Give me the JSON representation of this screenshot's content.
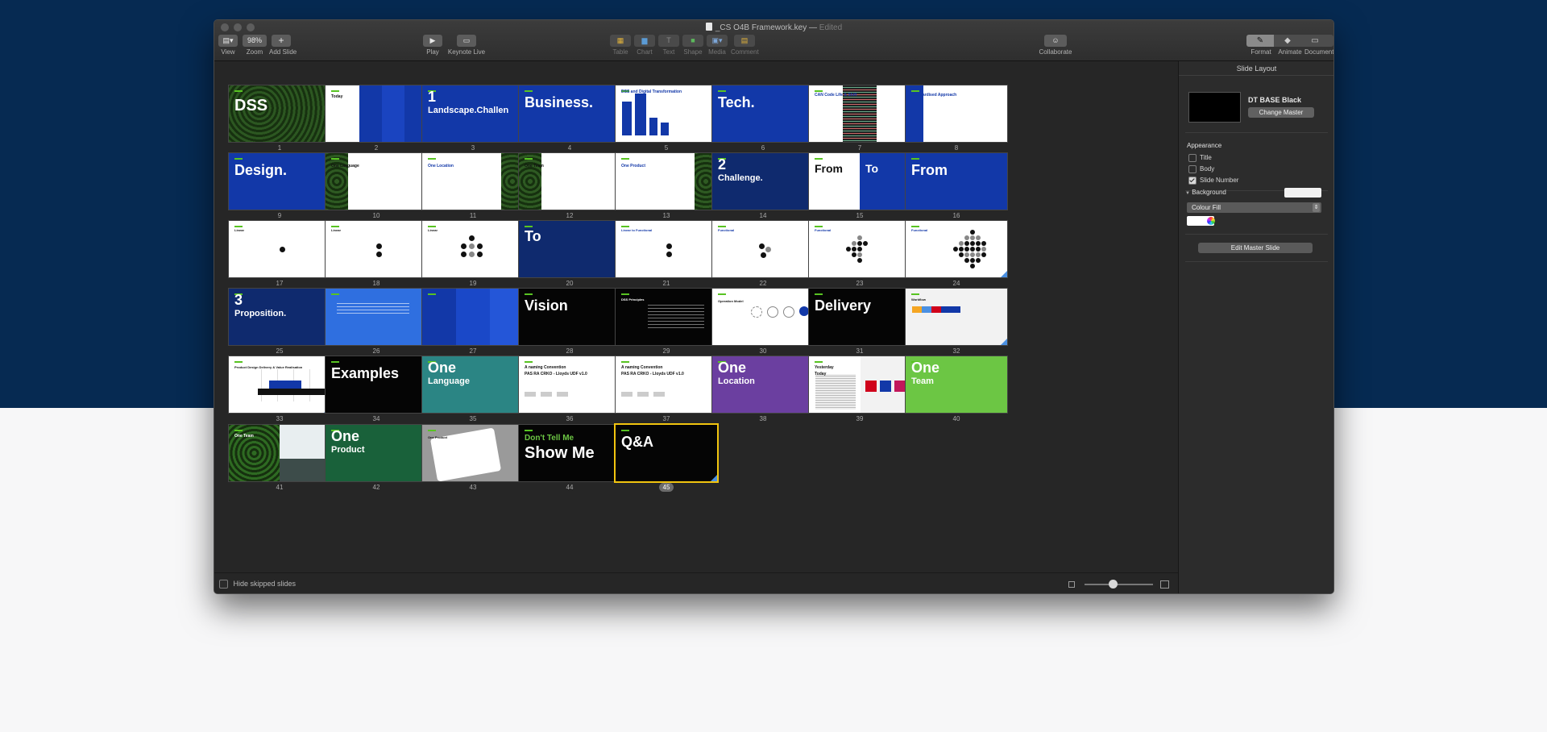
{
  "window": {
    "title": "_CS O4B Framework.key",
    "edited": "Edited"
  },
  "toolbar": {
    "view": "View",
    "zoom_value": "98%",
    "zoom": "Zoom",
    "add_slide": "Add Slide",
    "play": "Play",
    "keynote_live": "Keynote Live",
    "table": "Table",
    "chart": "Chart",
    "text": "Text",
    "shape": "Shape",
    "media": "Media",
    "comment": "Comment",
    "collaborate": "Collaborate",
    "format": "Format",
    "animate": "Animate",
    "document": "Document"
  },
  "colors": {
    "blue": "#1238a8",
    "navy": "#0f2a6e",
    "green": "#58c322",
    "lime": "#6cc644",
    "teal": "#2b8584",
    "purple": "#6b3fa0",
    "darkgreen": "#19613a",
    "brightblue": "#2f6fe0",
    "selection": "#f1c40f"
  },
  "slides": [
    {
      "n": "1",
      "text": "DSS",
      "bg": "#1f3a1a",
      "fg": "#ffffff",
      "size": 20,
      "y": 15,
      "pattern": "texture"
    },
    {
      "n": "2",
      "text": "Today",
      "bg": "#ffffff",
      "fg": "#111111",
      "size": 5,
      "y": 12,
      "pattern": "today"
    },
    {
      "n": "3",
      "text": "1",
      "text2": "Landscape.Challen",
      "bg": "#1238a8",
      "fg": "#ffffff",
      "size": 18,
      "y": 5
    },
    {
      "n": "4",
      "text": "Business.",
      "bg": "#1238a8",
      "fg": "#ffffff",
      "size": 18,
      "y": 12
    },
    {
      "n": "5",
      "text": "DSS and Digital Transformation",
      "bg": "#ffffff",
      "fg": "#1238a8",
      "size": 5,
      "y": 6,
      "pattern": "bars"
    },
    {
      "n": "6",
      "text": "Tech.",
      "bg": "#1238a8",
      "fg": "#ffffff",
      "size": 18,
      "y": 12
    },
    {
      "n": "7",
      "text": "CAN Code Life & Shift",
      "bg": "#ffffff",
      "fg": "#1238a8",
      "size": 5,
      "y": 10,
      "pattern": "code"
    },
    {
      "n": "8",
      "text": "Standardised Approach",
      "bg": "#ffffff",
      "fg": "#1238a8",
      "size": 5,
      "y": 10,
      "pattern": "bluepanel"
    },
    {
      "n": "9",
      "text": "Design.",
      "bg": "#1238a8",
      "fg": "#ffffff",
      "size": 18,
      "y": 12
    },
    {
      "n": "10",
      "text": "One Language",
      "bg": "#ffffff",
      "fg": "#111111",
      "size": 5,
      "y": 14,
      "pattern": "leftimg"
    },
    {
      "n": "11",
      "text": "One Location",
      "bg": "#ffffff",
      "fg": "#1238a8",
      "size": 5,
      "y": 14,
      "pattern": "rightimg"
    },
    {
      "n": "12",
      "text": "One Team",
      "bg": "#ffffff",
      "fg": "#111111",
      "size": 5,
      "y": 14,
      "pattern": "leftimg"
    },
    {
      "n": "13",
      "text": "One Product",
      "bg": "#ffffff",
      "fg": "#1238a8",
      "size": 5,
      "y": 14,
      "pattern": "rightimg"
    },
    {
      "n": "14",
      "text": "2",
      "text2": "Challenge.",
      "bg": "#0f2a6e",
      "fg": "#ffffff",
      "size": 18,
      "y": 5
    },
    {
      "n": "15",
      "text": "From",
      "text2": "To",
      "bg": "#ffffff",
      "fg": "#111111",
      "size": 14,
      "y": 12,
      "pattern": "fromto"
    },
    {
      "n": "16",
      "text": "From",
      "bg": "#1238a8",
      "fg": "#ffffff",
      "size": 18,
      "y": 12
    },
    {
      "n": "17",
      "text": "Linear",
      "bg": "#ffffff",
      "fg": "#111111",
      "size": 4,
      "y": 10,
      "dots": 1
    },
    {
      "n": "18",
      "text": "Linear",
      "bg": "#ffffff",
      "fg": "#111111",
      "size": 4,
      "y": 10,
      "dots": 2
    },
    {
      "n": "19",
      "text": "Linear",
      "bg": "#ffffff",
      "fg": "#111111",
      "size": 4,
      "y": 10,
      "dots": 6
    },
    {
      "n": "20",
      "text": "To",
      "bg": "#0f2a6e",
      "fg": "#ffffff",
      "size": 18,
      "y": 10
    },
    {
      "n": "21",
      "text": "Linear to Functional",
      "bg": "#ffffff",
      "fg": "#1238a8",
      "size": 4,
      "y": 10,
      "dots": 2
    },
    {
      "n": "22",
      "text": "Functional",
      "bg": "#ffffff",
      "fg": "#1238a8",
      "size": 4,
      "y": 10,
      "dots": 3
    },
    {
      "n": "23",
      "text": "Functional",
      "bg": "#ffffff",
      "fg": "#1238a8",
      "size": 4,
      "y": 10,
      "dots": 10
    },
    {
      "n": "24",
      "text": "Functional",
      "bg": "#ffffff",
      "fg": "#1238a8",
      "size": 4,
      "y": 10,
      "dots": 24
    },
    {
      "n": "25",
      "text": "3",
      "text2": "Proposition.",
      "bg": "#0f2a6e",
      "fg": "#ffffff",
      "size": 18,
      "y": 5
    },
    {
      "n": "26",
      "text": "",
      "bg": "#2f6fe0",
      "fg": "#ffffff",
      "size": 5,
      "y": 14,
      "pattern": "quote"
    },
    {
      "n": "27",
      "text": "",
      "bg": "#1238a8",
      "fg": "#ffffff",
      "size": 5,
      "y": 14,
      "pattern": "three"
    },
    {
      "n": "28",
      "text": "Vision",
      "bg": "#050505",
      "fg": "#ffffff",
      "size": 18,
      "y": 12
    },
    {
      "n": "29",
      "text": "DSS Principles",
      "bg": "#050505",
      "fg": "#ffffff",
      "size": 4,
      "y": 12,
      "pattern": "text"
    },
    {
      "n": "30",
      "text": "Operation Model",
      "bg": "#ffffff",
      "fg": "#111111",
      "size": 4,
      "y": 14,
      "pattern": "circles"
    },
    {
      "n": "31",
      "text": "Delivery",
      "bg": "#050505",
      "fg": "#ffffff",
      "size": 18,
      "y": 12
    },
    {
      "n": "32",
      "text": "Workflow",
      "bg": "#f2f2f2",
      "fg": "#111111",
      "size": 4,
      "y": 12,
      "pattern": "workflow"
    },
    {
      "n": "33",
      "text": "Product Design Delivery & Value Realisation",
      "bg": "#ffffff",
      "fg": "#111111",
      "size": 4,
      "y": 12,
      "pattern": "table"
    },
    {
      "n": "34",
      "text": "Examples",
      "bg": "#050505",
      "fg": "#ffffff",
      "size": 18,
      "y": 12
    },
    {
      "n": "35",
      "text": "One",
      "text2": "Language",
      "bg": "#2b8584",
      "fg": "#ffffff",
      "size": 18,
      "y": 5
    },
    {
      "n": "36",
      "text": "A naming Convention",
      "text2": "PAS RA CRKO - Lloyds UDF v1.0",
      "bg": "#ffffff",
      "fg": "#111111",
      "size": 5,
      "y": 12,
      "pattern": "naming"
    },
    {
      "n": "37",
      "text": "A naming Convention",
      "text2": "PAS RA CRKO - Lloyds UDF v1.0",
      "bg": "#ffffff",
      "fg": "#111111",
      "size": 5,
      "y": 12,
      "pattern": "naming"
    },
    {
      "n": "38",
      "text": "One",
      "text2": "Location",
      "bg": "#6b3fa0",
      "fg": "#ffffff",
      "size": 18,
      "y": 5
    },
    {
      "n": "39",
      "text": "Yesterday",
      "text2": "Today",
      "bg": "#ffffff",
      "fg": "#111111",
      "size": 5,
      "y": 12,
      "pattern": "yt"
    },
    {
      "n": "40",
      "text": "One",
      "text2": "Team",
      "bg": "#6cc644",
      "fg": "#ffffff",
      "size": 18,
      "y": 5
    },
    {
      "n": "41",
      "text": "One Team",
      "bg": "#ffffff",
      "fg": "#ffffff",
      "size": 5,
      "y": 12,
      "pattern": "greenimg"
    },
    {
      "n": "42",
      "text": "One",
      "text2": "Product",
      "bg": "#19613a",
      "fg": "#ffffff",
      "size": 18,
      "y": 5
    },
    {
      "n": "43",
      "text": "One Product",
      "bg": "#9a9a9a",
      "fg": "#111111",
      "size": 4,
      "y": 14,
      "pattern": "tablet"
    },
    {
      "n": "44",
      "text": "Don't Tell Me",
      "text2": "Show Me",
      "bg": "#050505",
      "fg": "#6cc644",
      "size": 10,
      "y": 12,
      "pattern": "showme"
    },
    {
      "n": "45",
      "text": "Q&A",
      "bg": "#050505",
      "fg": "#ffffff",
      "size": 18,
      "y": 12,
      "selected": true
    }
  ],
  "bottombar": {
    "hide_skipped": "Hide skipped slides"
  },
  "inspector": {
    "title": "Slide Layout",
    "master_name": "DT BASE Black",
    "change_master": "Change Master",
    "appearance": "Appearance",
    "title_opt": "Title",
    "body_opt": "Body",
    "slide_number_opt": "Slide Number",
    "background": "Background",
    "fill_type": "Colour Fill",
    "edit_master": "Edit Master Slide"
  }
}
